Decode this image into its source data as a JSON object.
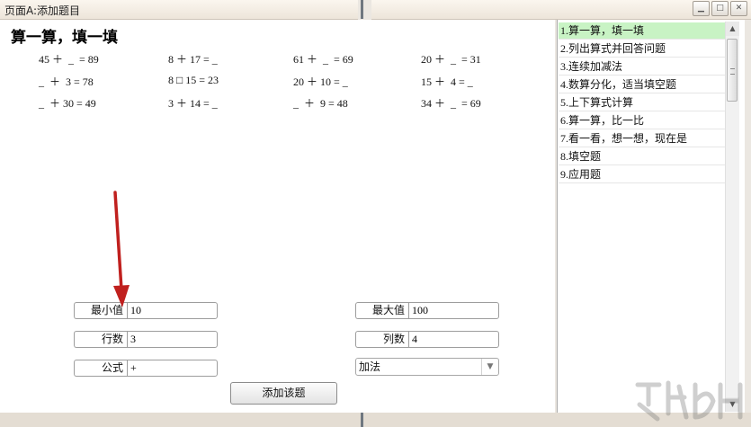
{
  "window": {
    "title": "页面A:添加题目"
  },
  "worksheet": {
    "heading": "算一算，填一填",
    "rows": [
      [
        "45 ＋  _  = 89",
        "8 ＋ 17 = _",
        "61 ＋  _  = 69",
        "20 ＋  _  = 31"
      ],
      [
        "_  ＋  3 = 78",
        "8 □ 15 = 23",
        "20 ＋ 10 = _",
        "15 ＋  4 = _"
      ],
      [
        "_  ＋ 30 = 49",
        "3 ＋ 14 = _",
        "_  ＋  9 = 48",
        "34 ＋  _  = 69"
      ]
    ]
  },
  "form": {
    "min_label": "最小值",
    "min_value": "10",
    "max_label": "最大值",
    "max_value": "100",
    "rows_label": "行数",
    "rows_value": "3",
    "cols_label": "列数",
    "cols_value": "4",
    "formula_label": "公式",
    "formula_value": "+",
    "operation_selected": "加法",
    "add_button": "添加该题"
  },
  "question_list": {
    "items": [
      {
        "num": "1.",
        "label": "算一算，填一填",
        "selected": true
      },
      {
        "num": "2.",
        "label": "列出算式并回答问题"
      },
      {
        "num": "3.",
        "label": "连续加减法"
      },
      {
        "num": "4.",
        "label": "数算分化，适当填空题"
      },
      {
        "num": "5.",
        "label": "上下算式计算"
      },
      {
        "num": "6.",
        "label": "算一算，比一比"
      },
      {
        "num": "7.",
        "label": "看一看，想一想，现在是"
      },
      {
        "num": "8.",
        "label": "填空题"
      },
      {
        "num": "9.",
        "label": "应用题"
      }
    ]
  },
  "colors": {
    "selected_item": "#c8f3c4",
    "annotation_arrow": "#c0201e"
  },
  "icons": {
    "minimize": "minimize-icon",
    "maximize": "maximize-icon",
    "close": "close-icon",
    "dropdown": "chevron-down-icon"
  }
}
